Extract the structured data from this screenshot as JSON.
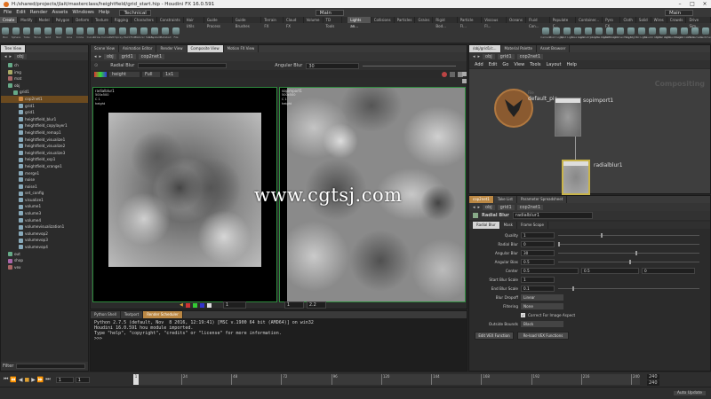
{
  "window": {
    "title": "H:/shared/projects/jlait/masterclass/heightfield/grid_start.hip - Houdini FX 16.0.591"
  },
  "menubar": {
    "items": [
      "File",
      "Edit",
      "Render",
      "Assets",
      "Windows",
      "Help"
    ],
    "desktop": "Technical",
    "main_label": "Main",
    "right_main": "Main"
  },
  "shelf": {
    "tabs_left": [
      "Create",
      "Modify",
      "Model",
      "Polygon",
      "Deform",
      "Texture",
      "Rigging",
      "Characters",
      "Constraints",
      "Hair Utils",
      "Guide Process",
      "Guide Brushes",
      "Terrain FX",
      "Cloud FX",
      "Volume",
      "TD Tools"
    ],
    "tabs_right": [
      "Lights an...",
      "Collisions",
      "Particles",
      "Grains",
      "Rigid Bod...",
      "Particle Fl...",
      "Viscous Fl...",
      "Oceans",
      "Fluid Con...",
      "Populate C...",
      "Container...",
      "Pyro FX",
      "Cloth",
      "Solid",
      "Wires",
      "Crowds",
      "Drive Sim..."
    ],
    "tools_left": [
      "Box",
      "Sphere",
      "Tube",
      "Torus",
      "Grid",
      "Null",
      "Line",
      "Circle",
      "Curve",
      "Draw Curve",
      "Path",
      "Spray Paint",
      "Font",
      "Platonic Solids",
      "L-System",
      "Metaball",
      "File"
    ],
    "tools_right": [
      "Camera",
      "Point Light",
      "Spot Light",
      "Area Light",
      "Geometry Light",
      "Volume Light",
      "Distant Light",
      "Environment Light",
      "Sky Light",
      "GI Light",
      "Caustic Light",
      "Portal Light",
      "Ambient Light",
      "Stereo Camera",
      "VR Camera",
      "Switcher"
    ]
  },
  "tree": {
    "header": "Tree View",
    "path": "obj",
    "items": [
      {
        "label": "ch",
        "depth": 1,
        "color": "#6a8"
      },
      {
        "label": "img",
        "depth": 1,
        "color": "#aa6"
      },
      {
        "label": "mat",
        "depth": 1,
        "color": "#a66"
      },
      {
        "label": "obj",
        "depth": 1,
        "color": "#6a8"
      },
      {
        "label": "grid1",
        "depth": 2,
        "color": "#6a8"
      },
      {
        "label": "cop2net1",
        "depth": 3,
        "color": "#c84",
        "selected": true
      },
      {
        "label": "grid1",
        "depth": 3,
        "color": "#8ab"
      },
      {
        "label": "grid1",
        "depth": 3,
        "color": "#8ab"
      },
      {
        "label": "heightfield_blur1",
        "depth": 3,
        "color": "#8ab"
      },
      {
        "label": "heightfield_copylayer1",
        "depth": 3,
        "color": "#8ab"
      },
      {
        "label": "heightfield_remap1",
        "depth": 3,
        "color": "#8ab"
      },
      {
        "label": "heightfield_visualize1",
        "depth": 3,
        "color": "#8ab"
      },
      {
        "label": "heightfield_visualize2",
        "depth": 3,
        "color": "#8ab"
      },
      {
        "label": "heightfield_visualize3",
        "depth": 3,
        "color": "#8ab"
      },
      {
        "label": "heightfield_xsp1",
        "depth": 3,
        "color": "#8ab"
      },
      {
        "label": "heightfield_xrange1",
        "depth": 3,
        "color": "#8ab"
      },
      {
        "label": "merge1",
        "depth": 3,
        "color": "#8ab"
      },
      {
        "label": "noise",
        "depth": 3,
        "color": "#8ab"
      },
      {
        "label": "noise1",
        "depth": 3,
        "color": "#8ab"
      },
      {
        "label": "set_config",
        "depth": 3,
        "color": "#8ab"
      },
      {
        "label": "visualize1",
        "depth": 3,
        "color": "#8ab"
      },
      {
        "label": "volume1",
        "depth": 3,
        "color": "#8ab"
      },
      {
        "label": "volume3",
        "depth": 3,
        "color": "#8ab"
      },
      {
        "label": "volume4",
        "depth": 3,
        "color": "#8ab"
      },
      {
        "label": "volumevisualization1",
        "depth": 3,
        "color": "#8ab"
      },
      {
        "label": "volumevop2",
        "depth": 3,
        "color": "#8ab"
      },
      {
        "label": "volumevop3",
        "depth": 3,
        "color": "#8ab"
      },
      {
        "label": "volumevop4",
        "depth": 3,
        "color": "#8ab"
      },
      {
        "label": "out",
        "depth": 1,
        "color": "#6a8"
      },
      {
        "label": "shop",
        "depth": 1,
        "color": "#a6a"
      },
      {
        "label": "vex",
        "depth": 1,
        "color": "#a66"
      }
    ],
    "filter_label": "Filter"
  },
  "viewer": {
    "tabs": [
      "Scene View",
      "Animation Editor",
      "Render View",
      "Composite View",
      "Motion FX View"
    ],
    "path_obj": "obj",
    "path_grid": "grid1",
    "path_cop": "cop2net1",
    "param1_label": "Radial Blur",
    "param2_label": "Angular Blur",
    "param2_value": "30",
    "toolbar_items": [
      "height",
      "Full",
      "1x1"
    ],
    "left_image": {
      "name": "radialblur1",
      "res": "500x500",
      "line2": "C 1",
      "line3": "height"
    },
    "right_image": {
      "name": "sopimport1",
      "res": "500x500",
      "line2": "C 1",
      "line3": "height"
    },
    "bottom_frame": "1",
    "bottom_value1": "1",
    "bottom_value2": "2.2"
  },
  "network": {
    "tabs": [
      "/obj/grid1/c...",
      "Material Palette",
      "Asset Browser"
    ],
    "path_obj": "obj",
    "path_grid": "grid1",
    "path_cop": "cop2net1",
    "menu": [
      "Add",
      "Edit",
      "Go",
      "View",
      "Tools",
      "Layout",
      "Help"
    ],
    "context_label": "Compositing",
    "nodes": [
      {
        "name": "default_pic",
        "kind": "File"
      },
      {
        "name": "sopimport1",
        "kind": ""
      },
      {
        "name": "radialblur1",
        "kind": ""
      }
    ]
  },
  "params": {
    "tabs": [
      "Take List",
      "Parameter Spreadsheet"
    ],
    "path_obj": "obj",
    "path_grid": "grid1",
    "path_cop": "cop2net1",
    "node_type": "Radial Blur",
    "node_name": "radialblur1",
    "subtabs": [
      "Radial Blur",
      "Mask",
      "Frame Scope"
    ],
    "rows": [
      {
        "label": "Quality",
        "value": "1",
        "slider": 0.3
      },
      {
        "label": "Radial Blur",
        "value": "0",
        "slider": 0.0
      },
      {
        "label": "Angular Blur",
        "value": "30",
        "slider": 0.55
      },
      {
        "label": "Angular Bias",
        "value": "0.5",
        "slider": 0.5
      }
    ],
    "center": {
      "label": "Center",
      "x": "0.5",
      "y": "0.5",
      "z": "0"
    },
    "start_scale": {
      "label": "Start Blur Scale",
      "value": "1"
    },
    "end_scale": {
      "label": "End Blur Scale",
      "value": "0.1",
      "slider": 0.1
    },
    "dropoff": {
      "label": "Blur Dropoff",
      "value": "Linear"
    },
    "filtering": {
      "label": "Filtering",
      "value": "None"
    },
    "aspect": {
      "label": "Correct For Image Aspect"
    },
    "outside": {
      "label": "Outside Bounds",
      "value": "Black"
    },
    "btn1": "Edit VEX Function",
    "btn2": "Re-load VEX Functions"
  },
  "console": {
    "tabs": [
      "Python Shell",
      "Textport",
      "Render Scheduler"
    ],
    "lines": [
      "Python 2.7.5 (default, Nov  8 2016, 12:19:41) [MSC v.1900 64 bit (AMD64)] on win32",
      "Houdini 16.0.591 hou module imported.",
      "Type \"help\", \"copyright\", \"credits\" or \"license\" for more information.",
      ">>>"
    ]
  },
  "timeline": {
    "start_field": "1",
    "end_field": "1",
    "current": "1",
    "ticks": [
      "1",
      "24",
      "48",
      "72",
      "96",
      "120",
      "144",
      "168",
      "192",
      "216",
      "240"
    ],
    "end_a": "240",
    "end_b": "240",
    "autosave": "Auto Update"
  },
  "watermark": "www.cgtsj.com",
  "colors": {
    "accent": "#c8841f",
    "selected": "#c84",
    "viewer_border": "#2e8b3e"
  }
}
